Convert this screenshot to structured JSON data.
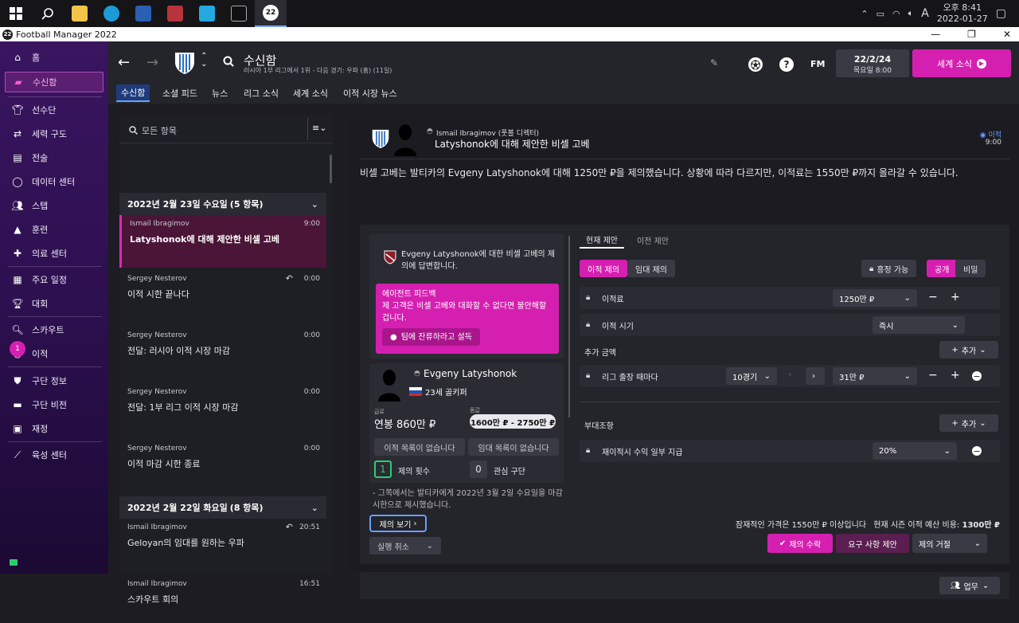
{
  "taskbar": {
    "clock_time": "오후 8:41",
    "clock_date": "2022-01-27",
    "ime_label": "A",
    "app_badge": "22"
  },
  "window": {
    "title": "Football Manager 2022",
    "badge": "22"
  },
  "sidebar": {
    "items": [
      {
        "label": "홈",
        "icon": "home-icon"
      },
      {
        "label": "수신함",
        "icon": "inbox-icon"
      },
      {
        "label": "선수단",
        "icon": "shirt-icon"
      },
      {
        "label": "세력 구도",
        "icon": "dynamics-icon"
      },
      {
        "label": "전술",
        "icon": "tactics-icon"
      },
      {
        "label": "데이터 센터",
        "icon": "data-icon"
      },
      {
        "label": "스탭",
        "icon": "staff-icon"
      },
      {
        "label": "훈련",
        "icon": "training-icon"
      },
      {
        "label": "의료 센터",
        "icon": "medical-icon"
      },
      {
        "label": "주요 일정",
        "icon": "calendar-icon"
      },
      {
        "label": "대회",
        "icon": "trophy-icon"
      },
      {
        "label": "스카우트",
        "icon": "scout-icon"
      },
      {
        "label": "이적",
        "icon": "transfer-icon"
      },
      {
        "label": "구단 정보",
        "icon": "club-icon"
      },
      {
        "label": "구단 비전",
        "icon": "vision-icon"
      },
      {
        "label": "재정",
        "icon": "finance-icon"
      },
      {
        "label": "육성 센터",
        "icon": "development-icon"
      }
    ],
    "transfer_badge": "1"
  },
  "topbar": {
    "title": "수신함",
    "subtitle": "러시아 1부 리그에서 1위 - 다음 경기: 우파 (홈) (11일)",
    "fm_label": "FM",
    "date": "22/2/24",
    "weekday_time": "목요일 8:00",
    "world_news": "세계 소식"
  },
  "tabs": [
    "수신함",
    "소셜 피드",
    "뉴스",
    "리그 소식",
    "세계 소식",
    "이적 시장 뉴스"
  ],
  "list": {
    "search_placeholder": "모든 항목",
    "groups": [
      {
        "date": "2022년 2월 23일 수요일",
        "count": "(5 항목)"
      },
      {
        "date": "2022년 2월 22일 화요일",
        "count": "(8 항목)"
      }
    ],
    "messages": [
      {
        "from": "Ismail Ibragimov",
        "subject": "Latyshonok에 대해 제안한 비셀 고베",
        "time": "9:00"
      },
      {
        "from": "Sergey Nesterov",
        "subject": "이적 시한 끝나다",
        "time": "0:00"
      },
      {
        "from": "Sergey Nesterov",
        "subject": "전달: 러시아 이적 시장 마감",
        "time": "0:00"
      },
      {
        "from": "Sergey Nesterov",
        "subject": "전달: 1부 리그 이적 시장 마감",
        "time": "0:00"
      },
      {
        "from": "Sergey Nesterov",
        "subject": "이적 마감 시한 종료",
        "time": "0:00"
      },
      {
        "from": "Ismail Ibragimov",
        "subject": "Geloyan의 임대를 원하는 우파",
        "time": "20:51"
      },
      {
        "from": "Ismail Ibragimov",
        "subject": "스카우트 회의",
        "time": "16:51"
      }
    ]
  },
  "mail": {
    "sender": "Ismail Ibragimov",
    "sender_role": "(풋볼 디렉터)",
    "title": "Latyshonok에 대해 제안한 비셀 고베",
    "tag": "이적",
    "time": "9:00",
    "body": "비셀 고베는 발티카의 Evgeny Latyshonok에 대해 1250만 ₽을 제의했습니다. 상황에 따라 다르지만, 이적료는 1550만 ₽까지 올라갈 수 있습니다."
  },
  "reply": {
    "text": "Evgeny Latyshonok에 대한 비셀 고베의 제의에 답변합니다.",
    "feedback_title": "에이전트 피드백",
    "feedback_body": "제 고객은 비셀 고베와 대화할 수 없다면 불안해할 겁니다.",
    "persuade": "팀에 잔류하라고 설득"
  },
  "player": {
    "name": "Evgeny Latyshonok",
    "position": "23세 골키퍼",
    "salary_label": "급료",
    "salary": "연봉 860만 ₽",
    "value_label": "몸값",
    "value": "1600만 ₽ - 2750만 ₽",
    "transfer_status": "이적 목록이 없습니다",
    "loan_status": "임대 목록이 없습니다",
    "offers_count": "1",
    "offers_label": "제의 횟수",
    "interest_count": "0",
    "interest_label": "관심 구단",
    "note": "- 그쪽에서는 발티카에게 2022년 3월 2일 수요일을 마감 시한으로 제시했습니다.",
    "view_offer": "제의 보기",
    "undo": "실행 취소"
  },
  "offer": {
    "tabs": [
      "현재 제안",
      "이전 제안"
    ],
    "mode": [
      "이적 제의",
      "임대 제의"
    ],
    "negotiable": "흥정 가능",
    "visibility": [
      "공개",
      "비밀"
    ],
    "fee_label": "이적료",
    "fee_value": "1250만 ₽",
    "timing_label": "이적 시기",
    "timing_value": "즉시",
    "extra_label": "추가 금액",
    "add_label": "추가",
    "appearance_label": "리그 출장 때마다",
    "appearance_games": "10경기",
    "appearance_amount": "31만 ₽",
    "clauses_label": "부대조항",
    "sellon_label": "재이적시 수익 일부 지급",
    "sellon_value": "20%",
    "footer_info": "잠재적인 가격은 1550만 ₽ 이상입니다",
    "budget_label": "현재 시즌 이적 예산 비용:",
    "budget_value": "1300만 ₽",
    "accept": "제의 수락",
    "counter": "요구 사항 제안",
    "reject": "제의 거절",
    "tasks": "업무"
  }
}
